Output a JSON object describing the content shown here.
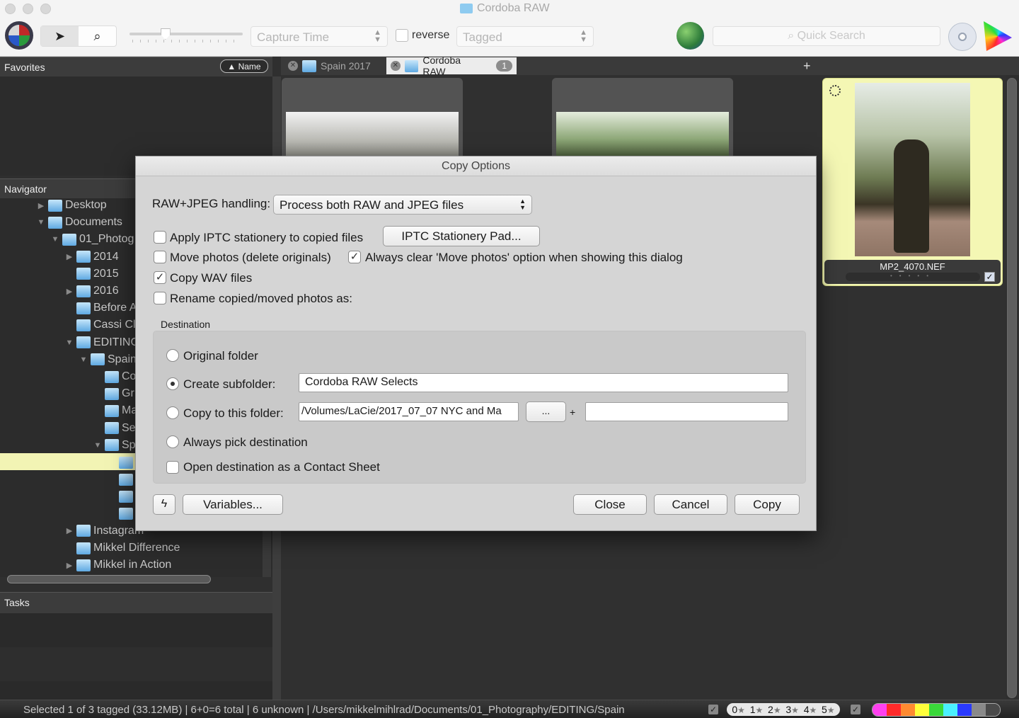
{
  "window": {
    "title": "Cordoba RAW"
  },
  "toolbar": {
    "sort_field": "Capture Time",
    "reverse_label": "reverse",
    "reverse_checked": false,
    "filter_field": "Tagged",
    "search_placeholder": "Quick Search",
    "thumb_size_slider_fraction": 0.3
  },
  "favorites": {
    "title": "Favorites",
    "sort_button": "▲ Name"
  },
  "navigator": {
    "title": "Navigator",
    "items": [
      {
        "label": "Desktop",
        "expander": "▶"
      },
      {
        "label": "Documents",
        "expander": "▼"
      },
      {
        "label": "01_Photog",
        "expander": "▼"
      },
      {
        "label": "2014",
        "expander": "▶"
      },
      {
        "label": "2015",
        "expander": ""
      },
      {
        "label": "2016",
        "expander": "▶"
      },
      {
        "label": "Before A",
        "expander": ""
      },
      {
        "label": "Cassi Cl",
        "expander": ""
      },
      {
        "label": "EDITING",
        "expander": "▼"
      },
      {
        "label": "Spain",
        "expander": "▼"
      },
      {
        "label": "Co",
        "expander": ""
      },
      {
        "label": "Gr",
        "expander": ""
      },
      {
        "label": "Ma",
        "expander": ""
      },
      {
        "label": "Se",
        "expander": ""
      },
      {
        "label": "Sp",
        "expander": "▼"
      },
      {
        "label": "",
        "expander": ""
      },
      {
        "label": "",
        "expander": ""
      },
      {
        "label": "",
        "expander": ""
      },
      {
        "label": "",
        "expander": ""
      },
      {
        "label": "Instagram",
        "expander": "▶"
      },
      {
        "label": "Mikkel Difference",
        "expander": ""
      },
      {
        "label": "Mikkel in Action",
        "expander": "▶"
      }
    ]
  },
  "tasks": {
    "title": "Tasks"
  },
  "tabs": [
    {
      "label": "Spain 2017",
      "active": false
    },
    {
      "label": "Cordoba RAW",
      "active": true,
      "badge": "1"
    }
  ],
  "thumbnails": [
    {
      "filename": "MP2_4070.NEF",
      "selected": true,
      "tagged": true
    }
  ],
  "dialog": {
    "title": "Copy Options",
    "raw_jpeg_label": "RAW+JPEG handling:",
    "raw_jpeg_value": "Process both RAW and JPEG files",
    "apply_iptc_label": "Apply IPTC stationery to copied files",
    "apply_iptc_checked": false,
    "iptc_button": "IPTC Stationery Pad...",
    "move_photos_label": "Move photos (delete originals)",
    "move_photos_checked": false,
    "always_clear_label": "Always clear 'Move photos' option when showing this dialog",
    "always_clear_checked": true,
    "copy_wav_label": "Copy WAV files",
    "copy_wav_checked": true,
    "rename_label": "Rename copied/moved photos as:",
    "rename_checked": false,
    "destination": {
      "title": "Destination",
      "original_folder_label": "Original folder",
      "create_subfolder_label": "Create subfolder:",
      "create_subfolder_value": "Cordoba RAW Selects",
      "copy_to_folder_label": "Copy to this folder:",
      "copy_to_folder_path": "/Volumes/LaCie/2017_07_07 NYC and Ma",
      "browse_button": "...",
      "plus_label": "+",
      "copy_to_folder_suffix": "",
      "always_pick_label": "Always pick destination",
      "selected_option": "create_subfolder",
      "open_contact_sheet_label": "Open destination as a Contact Sheet",
      "open_contact_sheet_checked": false
    },
    "variables_button": "Variables...",
    "close_button": "Close",
    "cancel_button": "Cancel",
    "copy_button": "Copy"
  },
  "statusbar": {
    "text": "Selected 1 of 3 tagged (33.12MB) | 6+0=6 total | 6 unknown | /Users/mikkelmihlrad/Documents/01_Photography/EDITING/Spain",
    "rating_filters": [
      "0",
      "1",
      "2",
      "3",
      "4",
      "5"
    ],
    "color_filters": [
      "#ff40f0",
      "#ff2a2a",
      "#ff8a30",
      "#ffff3a",
      "#3ad83a",
      "#4af0ff",
      "#2a3aff",
      "#8a8a8a",
      "#4a4a4a"
    ]
  }
}
